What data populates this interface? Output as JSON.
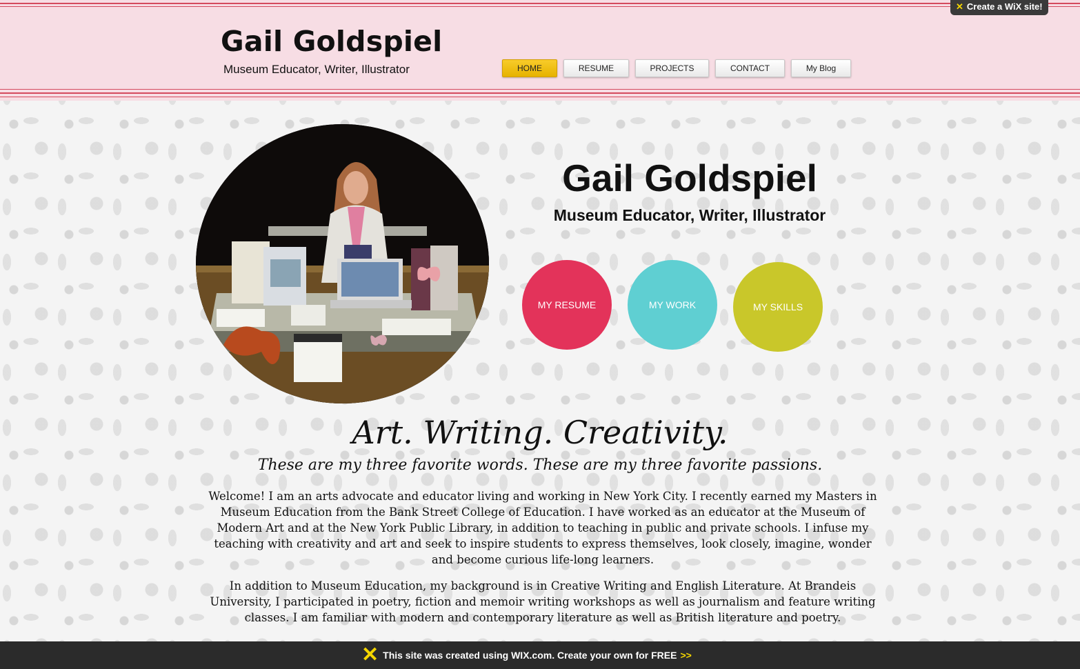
{
  "header": {
    "site_title": "Gail Goldspiel",
    "site_subtitle": "Museum Educator, Writer, Illustrator",
    "wix_badge": "Create a WiX site!"
  },
  "nav": [
    {
      "label": "HOME",
      "active": true
    },
    {
      "label": "RESUME",
      "active": false
    },
    {
      "label": "PROJECTS",
      "active": false
    },
    {
      "label": "CONTACT",
      "active": false
    },
    {
      "label": "My Blog",
      "active": false
    }
  ],
  "hero": {
    "title": "Gail Goldspiel",
    "subtitle": "Museum Educator, Writer, Illustrator",
    "circle_buttons": [
      {
        "label": "MY RESUME",
        "color": "#e3335a"
      },
      {
        "label": "MY WORK",
        "color": "#5fcfd2"
      },
      {
        "label": "MY SKILLS",
        "color": "#c9c72a"
      }
    ]
  },
  "content": {
    "tagline": "Art. Writing. Creativity.",
    "subtag": "These are my three favorite words. These are my three favorite passions.",
    "paragraph1": "Welcome! I am an arts advocate and educator living and working in New York City. I recently earned my Masters in Museum Education from the Bank Street College of Education. I have worked as an educator at the Museum of Modern Art and at the New York Public Library, in addition to teaching in public and private schools. I infuse my teaching with creativity and art and seek to inspire students to express themselves, look closely, imagine, wonder and become curious life-long learners.",
    "paragraph2": "In addition to Museum Education, my background is in Creative Writing and English Literature. At Brandeis University, I participated in poetry, fiction and memoir writing workshops as well as journalism and feature writing classes. I am familiar with modern and contemporary literature as well as British literature and poetry."
  },
  "footer": {
    "text": "This site was created using WIX.com. Create your own for FREE",
    "arrows": ">>"
  },
  "colors": {
    "header_bg": "#f7dde4",
    "header_line": "#d44a5e",
    "nav_active": "#f2c00e"
  },
  "icons": [
    "wix-x-icon"
  ]
}
